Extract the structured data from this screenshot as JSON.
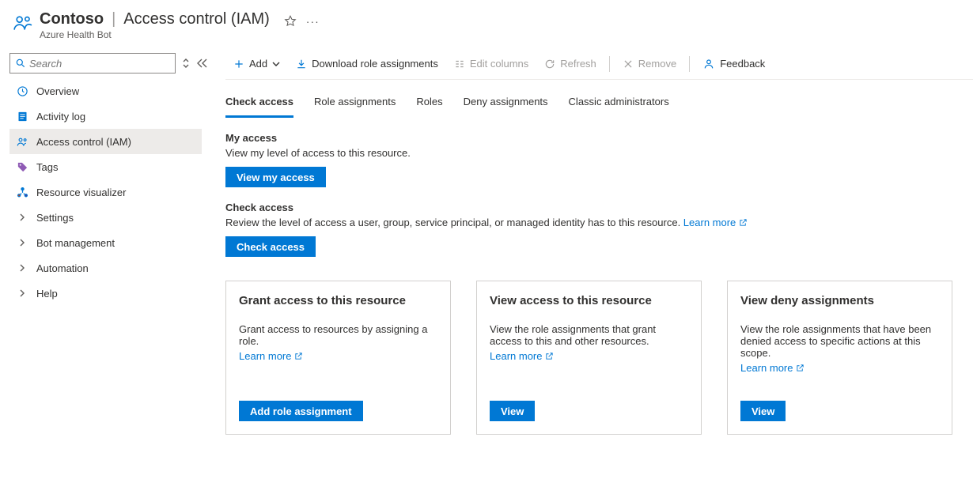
{
  "header": {
    "resource_name": "Contoso",
    "page_title": "Access control (IAM)",
    "subtitle": "Azure Health Bot"
  },
  "sidebar": {
    "search_placeholder": "Search",
    "items": [
      {
        "label": "Overview",
        "icon": "overview-icon"
      },
      {
        "label": "Activity log",
        "icon": "activity-log-icon"
      },
      {
        "label": "Access control (IAM)",
        "icon": "people-icon"
      },
      {
        "label": "Tags",
        "icon": "tags-icon"
      },
      {
        "label": "Resource visualizer",
        "icon": "visualizer-icon"
      },
      {
        "label": "Settings",
        "icon": "chevron-icon"
      },
      {
        "label": "Bot management",
        "icon": "chevron-icon"
      },
      {
        "label": "Automation",
        "icon": "chevron-icon"
      },
      {
        "label": "Help",
        "icon": "chevron-icon"
      }
    ]
  },
  "toolbar": {
    "add": "Add",
    "download": "Download role assignments",
    "edit_columns": "Edit columns",
    "refresh": "Refresh",
    "remove": "Remove",
    "feedback": "Feedback"
  },
  "tabs": {
    "items": [
      "Check access",
      "Role assignments",
      "Roles",
      "Deny assignments",
      "Classic administrators"
    ],
    "active": "Check access"
  },
  "my_access": {
    "heading": "My access",
    "desc": "View my level of access to this resource.",
    "button": "View my access"
  },
  "check_access": {
    "heading": "Check access",
    "desc": "Review the level of access a user, group, service principal, or managed identity has to this resource. ",
    "learn_more": "Learn more",
    "button": "Check access"
  },
  "cards": [
    {
      "title": "Grant access to this resource",
      "desc": "Grant access to resources by assigning a role.",
      "learn_more": "Learn more",
      "button": "Add role assignment"
    },
    {
      "title": "View access to this resource",
      "desc": "View the role assignments that grant access to this and other resources.",
      "learn_more": "Learn more",
      "button": "View"
    },
    {
      "title": "View deny assignments",
      "desc": "View the role assignments that have been denied access to specific actions at this scope.",
      "learn_more": "Learn more",
      "button": "View"
    }
  ]
}
